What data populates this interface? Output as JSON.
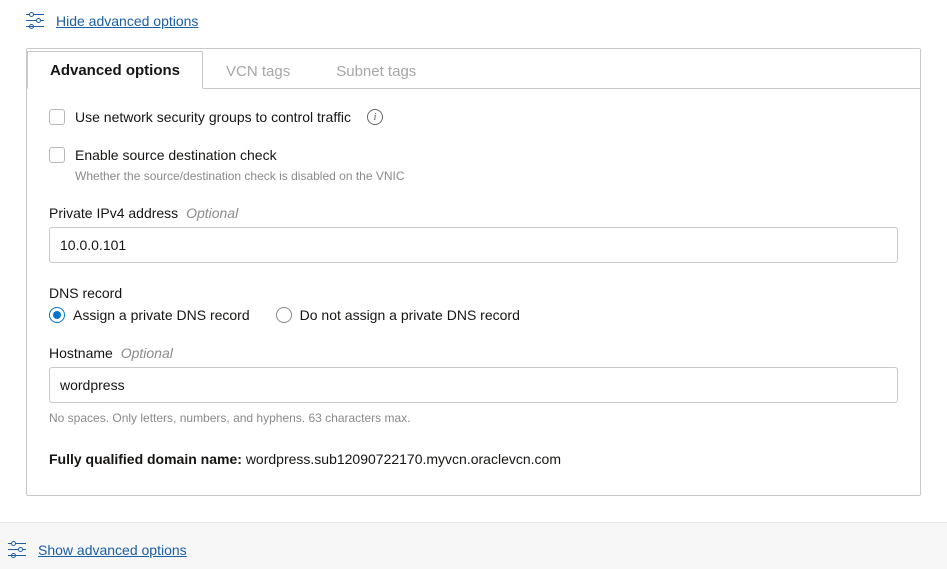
{
  "hide_link": "Hide advanced options",
  "show_link": "Show advanced options",
  "tabs": {
    "advanced": "Advanced options",
    "vcn": "VCN tags",
    "subnet": "Subnet tags"
  },
  "nsg": {
    "label": "Use network security groups to control traffic"
  },
  "src_dest": {
    "label": "Enable source destination check",
    "helper": "Whether the source/destination check is disabled on the VNIC"
  },
  "ipv4": {
    "label": "Private IPv4 address",
    "optional": "Optional",
    "value": "10.0.0.101"
  },
  "dns": {
    "legend": "DNS record",
    "opt_assign": "Assign a private DNS record",
    "opt_noassign": "Do not assign a private DNS record"
  },
  "hostname": {
    "label": "Hostname",
    "optional": "Optional",
    "value": "wordpress",
    "hint": "No spaces. Only letters, numbers, and hyphens. 63 characters max."
  },
  "fqdn": {
    "label": "Fully qualified domain name:",
    "value": "wordpress.sub12090722170.myvcn.oraclevcn.com"
  }
}
